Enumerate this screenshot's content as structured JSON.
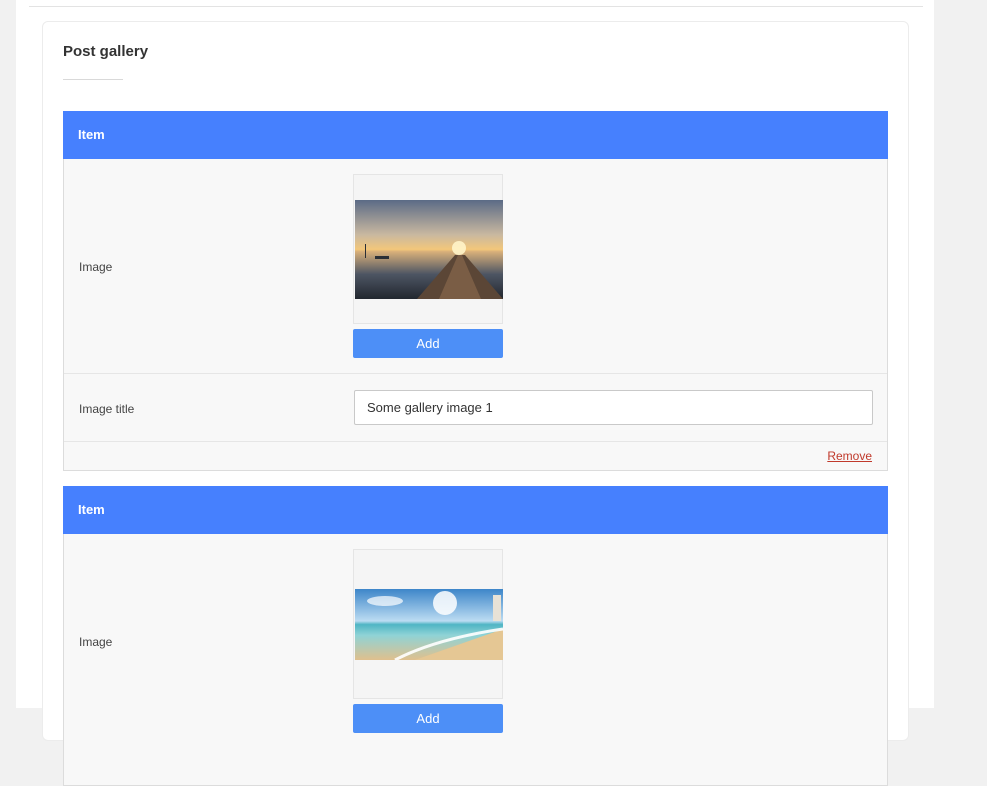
{
  "card": {
    "title": "Post gallery"
  },
  "items": [
    {
      "header": "Item",
      "image_label": "Image",
      "add_label": "Add",
      "title_label": "Image title",
      "title_value": "Some gallery image 1",
      "remove_label": "Remove"
    },
    {
      "header": "Item",
      "image_label": "Image",
      "add_label": "Add"
    }
  ],
  "colors": {
    "header_bg": "#4680fe",
    "add_button": "#4d8ff7",
    "remove_link": "#c0392b"
  }
}
